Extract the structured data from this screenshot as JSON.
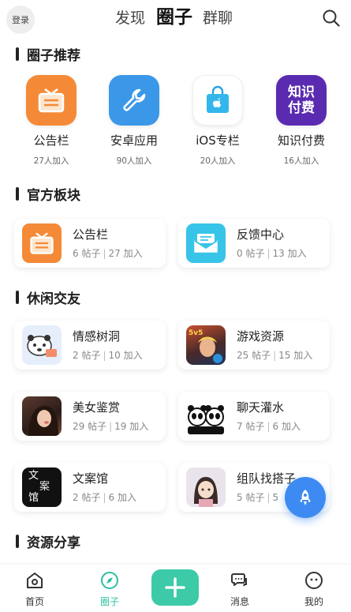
{
  "header": {
    "login": "登录",
    "tabs": [
      "发现",
      "圈子",
      "群聊"
    ],
    "active_tab": "圈子"
  },
  "recommend": {
    "title": "圈子推荐",
    "items": [
      {
        "label": "公告栏",
        "count": "27人加入",
        "icon": "noticeboard-icon",
        "color": "#f48a37"
      },
      {
        "label": "安卓应用",
        "count": "90人加入",
        "icon": "wrench-icon",
        "color": "#3b98e8"
      },
      {
        "label": "iOS专栏",
        "count": "20人加入",
        "icon": "apple-bag-icon",
        "color": "#33b6ec"
      },
      {
        "label": "知识付费",
        "count": "16人加入",
        "icon_text": "知识\n付费",
        "color": "#5a2bb0"
      }
    ]
  },
  "official": {
    "title": "官方板块",
    "cards": [
      {
        "name": "公告栏",
        "posts": "6 帖子",
        "joins": "27 加入",
        "icon": "noticeboard-icon"
      },
      {
        "name": "反馈中心",
        "posts": "0 帖子",
        "joins": "13 加入",
        "icon": "envelope-icon"
      }
    ]
  },
  "casual": {
    "title": "休闲交友",
    "cards": [
      {
        "name": "情感树洞",
        "posts": "2 帖子",
        "joins": "10 加入",
        "icon": "panda-sticker-icon"
      },
      {
        "name": "游戏资源",
        "posts": "25 帖子",
        "joins": "15 加入",
        "icon": "game-hero-image",
        "badge": "5v5"
      },
      {
        "name": "美女鉴赏",
        "posts": "29 帖子",
        "joins": "19 加入",
        "icon": "portrait-image"
      },
      {
        "name": "聊天灌水",
        "posts": "7 帖子",
        "joins": "6 加入",
        "icon": "panda-pair-icon"
      },
      {
        "name": "文案馆",
        "posts": "2 帖子",
        "joins": "6 加入",
        "icon": "calligraphy-image",
        "calligraphy": "文\n案\n馆"
      },
      {
        "name": "组队找搭子",
        "posts": "5 帖子",
        "joins": "5",
        "icon": "cartoon-girl-image"
      }
    ]
  },
  "resources": {
    "title": "资源分享"
  },
  "nav": {
    "items": [
      {
        "label": "首页",
        "icon": "home-icon"
      },
      {
        "label": "圈子",
        "icon": "compass-icon"
      },
      {
        "label": "消息",
        "icon": "chat-bubbles-icon"
      },
      {
        "label": "我的",
        "icon": "profile-face-icon"
      }
    ],
    "active": "圈子",
    "accent": "#2bc0a0"
  }
}
